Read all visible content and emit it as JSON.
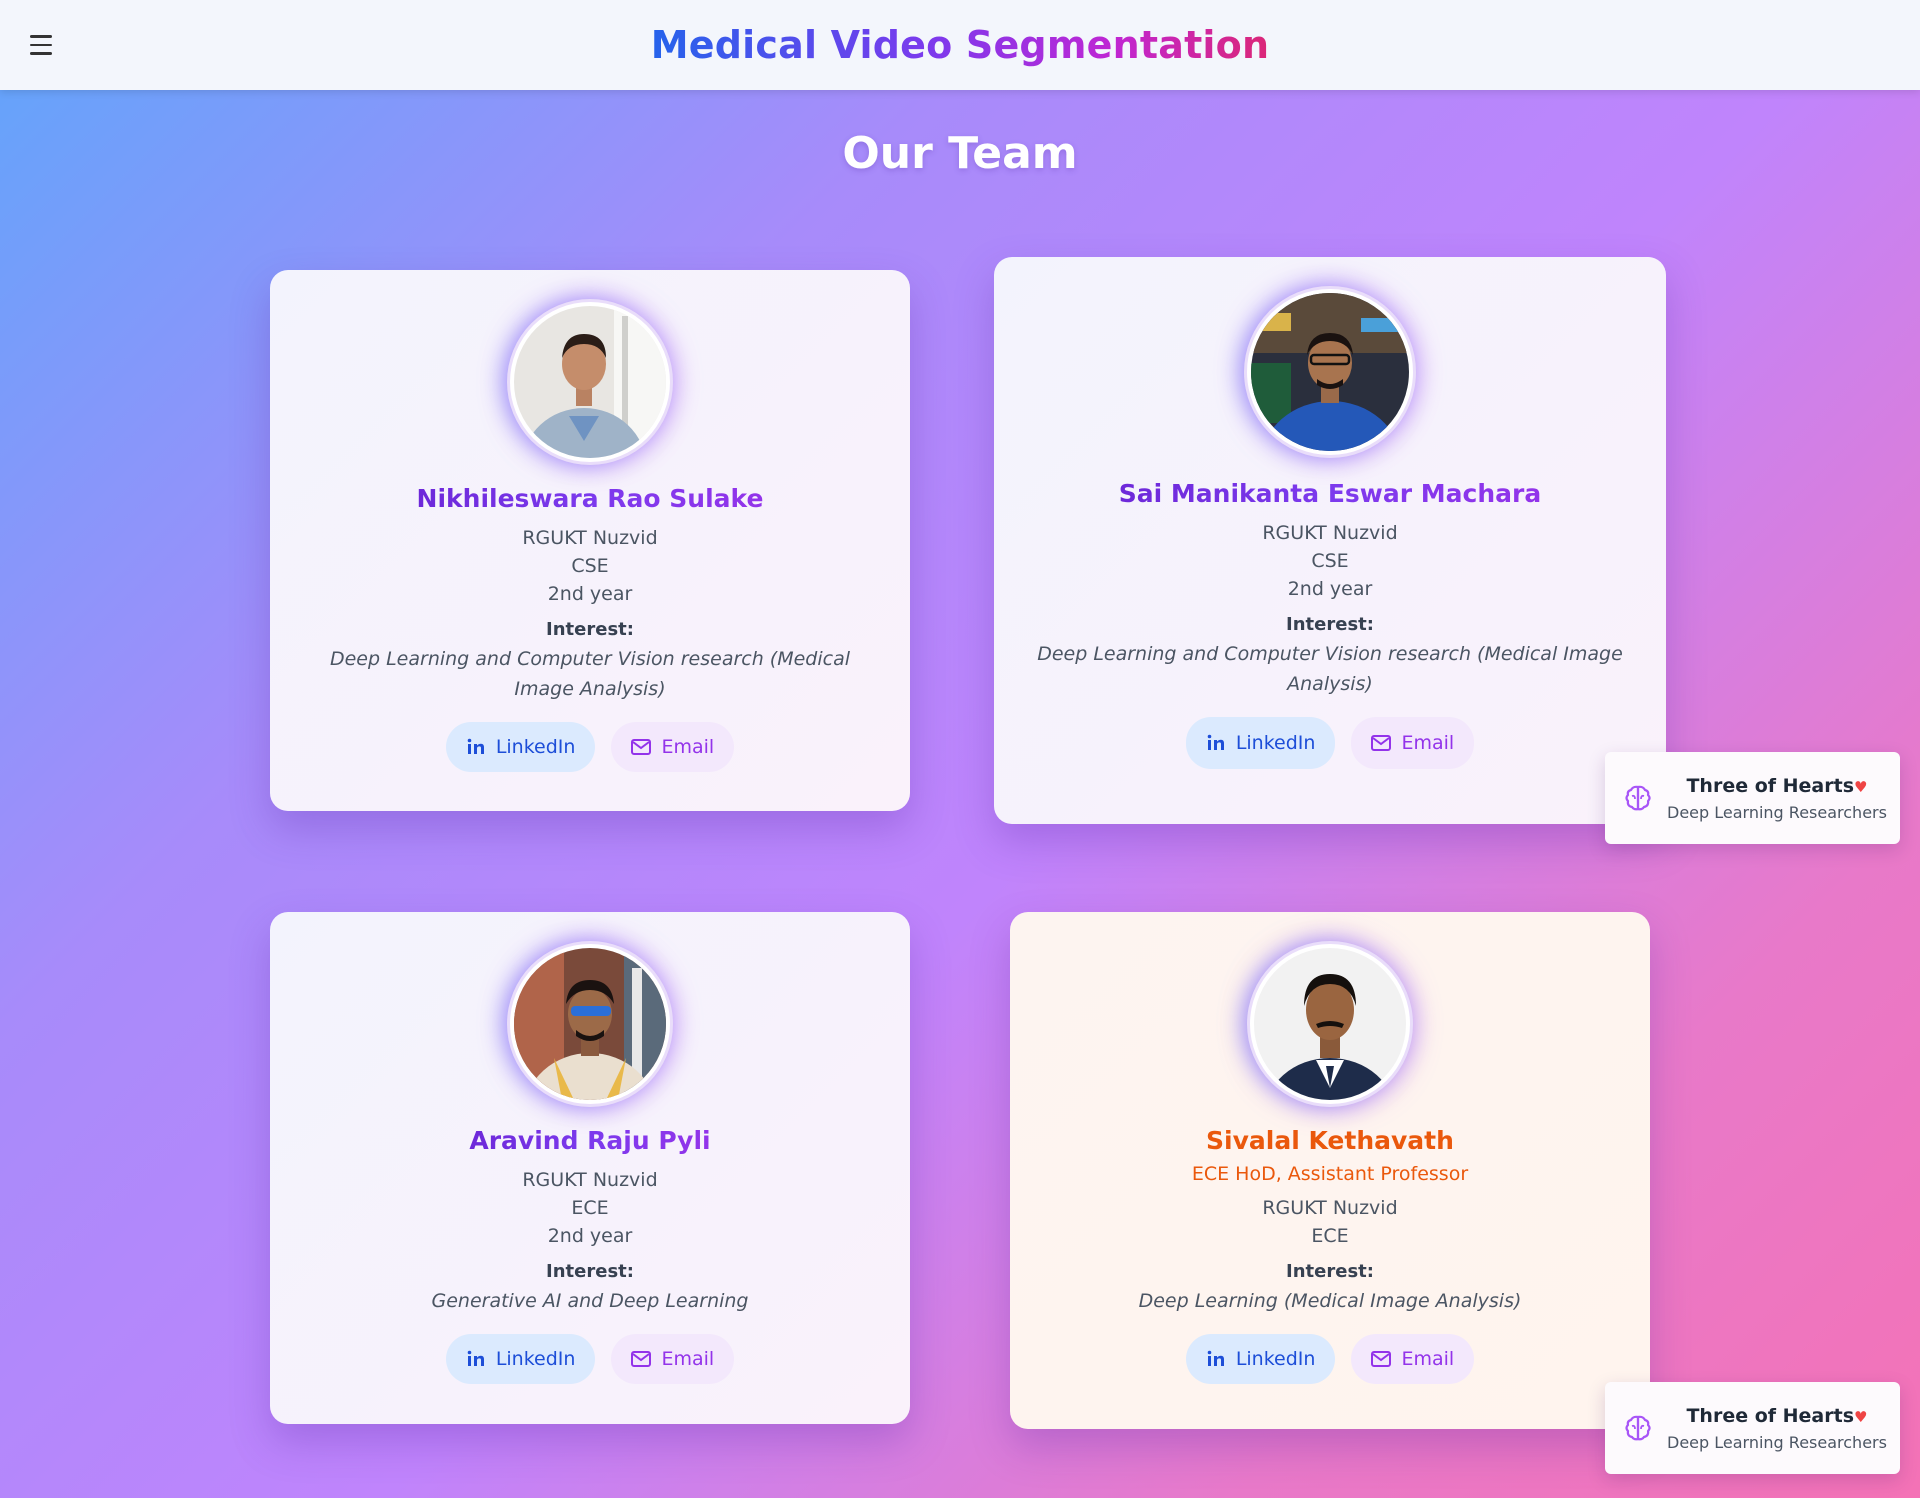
{
  "header": {
    "title": "Medical Video Segmentation",
    "menu_icon": "hamburger-menu-icon"
  },
  "page": {
    "heading": "Our Team"
  },
  "members": [
    {
      "name": "Nikhileswara Rao Sulake",
      "college": "RGUKT Nuzvid",
      "branch": "CSE",
      "year": "2nd year",
      "interest_label": "Interest:",
      "interest": "Deep Learning and Computer Vision research (Medical Image Analysis)",
      "linkedin_label": "LinkedIn",
      "email_label": "Email"
    },
    {
      "name": "Sai Manikanta Eswar Machara",
      "college": "RGUKT Nuzvid",
      "branch": "CSE",
      "year": "2nd year",
      "interest_label": "Interest:",
      "interest": "Deep Learning and Computer Vision research (Medical Image Analysis)",
      "linkedin_label": "LinkedIn",
      "email_label": "Email"
    },
    {
      "name": "Aravind Raju Pyli",
      "college": "RGUKT Nuzvid",
      "branch": "ECE",
      "year": "2nd year",
      "interest_label": "Interest:",
      "interest": "Generative AI and Deep Learning",
      "linkedin_label": "LinkedIn",
      "email_label": "Email"
    },
    {
      "name": "Sivalal Kethavath",
      "role": "ECE HoD, Assistant Professor",
      "college": "RGUKT Nuzvid",
      "branch": "ECE",
      "interest_label": "Interest:",
      "interest": "Deep Learning (Medical Image Analysis)",
      "linkedin_label": "LinkedIn",
      "email_label": "Email"
    }
  ],
  "toasts": [
    {
      "title": "Three of Hearts",
      "heart": "♥",
      "subtitle": "Deep Learning Researchers",
      "icon": "brain-icon"
    },
    {
      "title": "Three of Hearts",
      "heart": "♥",
      "subtitle": "Deep Learning Researchers",
      "icon": "brain-icon"
    }
  ],
  "colors": {
    "accent_purple": "#7c3aed",
    "accent_orange": "#ea580c",
    "linkedin_blue": "#1d4ed8",
    "email_purple": "#9333ea"
  }
}
